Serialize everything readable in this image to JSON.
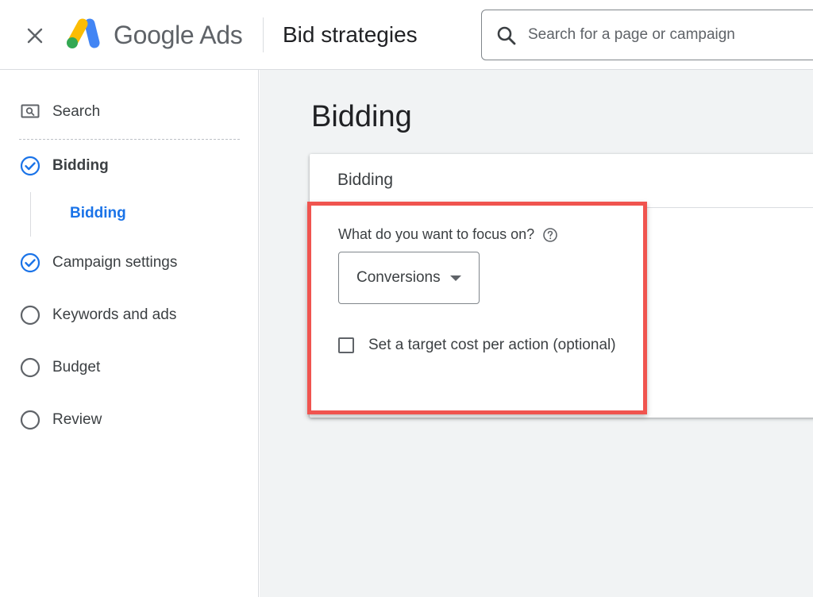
{
  "header": {
    "brand": "Google Ads",
    "page_title": "Bid strategies",
    "search_placeholder": "Search for a page or campaign",
    "icons": {
      "close": "close-icon",
      "logo": "google-ads-logo",
      "search": "search-icon"
    }
  },
  "sidebar": {
    "items": [
      {
        "label": "Search",
        "icon": "search-box-icon"
      },
      {
        "label": "Bidding",
        "icon": "check-circle-icon",
        "state": "completed"
      },
      {
        "label": "Bidding",
        "state": "current-subitem"
      },
      {
        "label": "Campaign settings",
        "icon": "check-circle-icon",
        "state": "completed"
      },
      {
        "label": "Keywords and ads",
        "icon": "empty-circle-icon",
        "state": "pending"
      },
      {
        "label": "Budget",
        "icon": "empty-circle-icon",
        "state": "pending"
      },
      {
        "label": "Review",
        "icon": "empty-circle-icon",
        "state": "pending"
      }
    ]
  },
  "main": {
    "title": "Bidding",
    "card": {
      "title": "Bidding",
      "question": "What do you want to focus on?",
      "focus_selected": "Conversions",
      "checkbox_label": "Set a target cost per action (optional)",
      "checkbox_checked": false
    }
  },
  "colors": {
    "accent_blue": "#1a73e8",
    "highlight_red": "#f0544f",
    "main_bg": "#f1f3f4"
  }
}
